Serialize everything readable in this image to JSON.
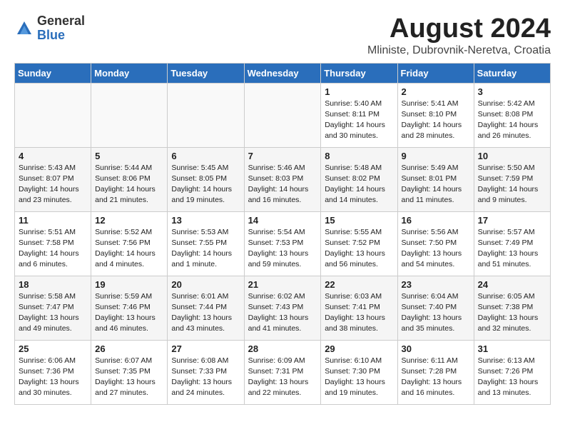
{
  "logo": {
    "general": "General",
    "blue": "Blue"
  },
  "title": {
    "month": "August 2024",
    "location": "Mliniste, Dubrovnik-Neretva, Croatia"
  },
  "weekdays": [
    "Sunday",
    "Monday",
    "Tuesday",
    "Wednesday",
    "Thursday",
    "Friday",
    "Saturday"
  ],
  "weeks": [
    [
      {
        "day": "",
        "info": ""
      },
      {
        "day": "",
        "info": ""
      },
      {
        "day": "",
        "info": ""
      },
      {
        "day": "",
        "info": ""
      },
      {
        "day": "1",
        "info": "Sunrise: 5:40 AM\nSunset: 8:11 PM\nDaylight: 14 hours\nand 30 minutes."
      },
      {
        "day": "2",
        "info": "Sunrise: 5:41 AM\nSunset: 8:10 PM\nDaylight: 14 hours\nand 28 minutes."
      },
      {
        "day": "3",
        "info": "Sunrise: 5:42 AM\nSunset: 8:08 PM\nDaylight: 14 hours\nand 26 minutes."
      }
    ],
    [
      {
        "day": "4",
        "info": "Sunrise: 5:43 AM\nSunset: 8:07 PM\nDaylight: 14 hours\nand 23 minutes."
      },
      {
        "day": "5",
        "info": "Sunrise: 5:44 AM\nSunset: 8:06 PM\nDaylight: 14 hours\nand 21 minutes."
      },
      {
        "day": "6",
        "info": "Sunrise: 5:45 AM\nSunset: 8:05 PM\nDaylight: 14 hours\nand 19 minutes."
      },
      {
        "day": "7",
        "info": "Sunrise: 5:46 AM\nSunset: 8:03 PM\nDaylight: 14 hours\nand 16 minutes."
      },
      {
        "day": "8",
        "info": "Sunrise: 5:48 AM\nSunset: 8:02 PM\nDaylight: 14 hours\nand 14 minutes."
      },
      {
        "day": "9",
        "info": "Sunrise: 5:49 AM\nSunset: 8:01 PM\nDaylight: 14 hours\nand 11 minutes."
      },
      {
        "day": "10",
        "info": "Sunrise: 5:50 AM\nSunset: 7:59 PM\nDaylight: 14 hours\nand 9 minutes."
      }
    ],
    [
      {
        "day": "11",
        "info": "Sunrise: 5:51 AM\nSunset: 7:58 PM\nDaylight: 14 hours\nand 6 minutes."
      },
      {
        "day": "12",
        "info": "Sunrise: 5:52 AM\nSunset: 7:56 PM\nDaylight: 14 hours\nand 4 minutes."
      },
      {
        "day": "13",
        "info": "Sunrise: 5:53 AM\nSunset: 7:55 PM\nDaylight: 14 hours\nand 1 minute."
      },
      {
        "day": "14",
        "info": "Sunrise: 5:54 AM\nSunset: 7:53 PM\nDaylight: 13 hours\nand 59 minutes."
      },
      {
        "day": "15",
        "info": "Sunrise: 5:55 AM\nSunset: 7:52 PM\nDaylight: 13 hours\nand 56 minutes."
      },
      {
        "day": "16",
        "info": "Sunrise: 5:56 AM\nSunset: 7:50 PM\nDaylight: 13 hours\nand 54 minutes."
      },
      {
        "day": "17",
        "info": "Sunrise: 5:57 AM\nSunset: 7:49 PM\nDaylight: 13 hours\nand 51 minutes."
      }
    ],
    [
      {
        "day": "18",
        "info": "Sunrise: 5:58 AM\nSunset: 7:47 PM\nDaylight: 13 hours\nand 49 minutes."
      },
      {
        "day": "19",
        "info": "Sunrise: 5:59 AM\nSunset: 7:46 PM\nDaylight: 13 hours\nand 46 minutes."
      },
      {
        "day": "20",
        "info": "Sunrise: 6:01 AM\nSunset: 7:44 PM\nDaylight: 13 hours\nand 43 minutes."
      },
      {
        "day": "21",
        "info": "Sunrise: 6:02 AM\nSunset: 7:43 PM\nDaylight: 13 hours\nand 41 minutes."
      },
      {
        "day": "22",
        "info": "Sunrise: 6:03 AM\nSunset: 7:41 PM\nDaylight: 13 hours\nand 38 minutes."
      },
      {
        "day": "23",
        "info": "Sunrise: 6:04 AM\nSunset: 7:40 PM\nDaylight: 13 hours\nand 35 minutes."
      },
      {
        "day": "24",
        "info": "Sunrise: 6:05 AM\nSunset: 7:38 PM\nDaylight: 13 hours\nand 32 minutes."
      }
    ],
    [
      {
        "day": "25",
        "info": "Sunrise: 6:06 AM\nSunset: 7:36 PM\nDaylight: 13 hours\nand 30 minutes."
      },
      {
        "day": "26",
        "info": "Sunrise: 6:07 AM\nSunset: 7:35 PM\nDaylight: 13 hours\nand 27 minutes."
      },
      {
        "day": "27",
        "info": "Sunrise: 6:08 AM\nSunset: 7:33 PM\nDaylight: 13 hours\nand 24 minutes."
      },
      {
        "day": "28",
        "info": "Sunrise: 6:09 AM\nSunset: 7:31 PM\nDaylight: 13 hours\nand 22 minutes."
      },
      {
        "day": "29",
        "info": "Sunrise: 6:10 AM\nSunset: 7:30 PM\nDaylight: 13 hours\nand 19 minutes."
      },
      {
        "day": "30",
        "info": "Sunrise: 6:11 AM\nSunset: 7:28 PM\nDaylight: 13 hours\nand 16 minutes."
      },
      {
        "day": "31",
        "info": "Sunrise: 6:13 AM\nSunset: 7:26 PM\nDaylight: 13 hours\nand 13 minutes."
      }
    ]
  ]
}
